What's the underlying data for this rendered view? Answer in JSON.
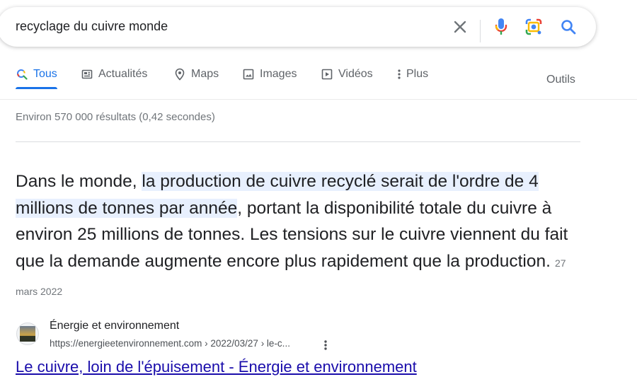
{
  "search": {
    "query": "recyclage du cuivre monde",
    "icons": {
      "clear": "close-icon",
      "voice": "microphone-icon",
      "lens": "camera-lens-icon",
      "search": "search-icon"
    }
  },
  "tabs": [
    {
      "label": "Tous",
      "icon": "search-icon",
      "active": true
    },
    {
      "label": "Actualités",
      "icon": "news-icon",
      "active": false
    },
    {
      "label": "Maps",
      "icon": "map-pin-icon",
      "active": false
    },
    {
      "label": "Images",
      "icon": "image-icon",
      "active": false
    },
    {
      "label": "Vidéos",
      "icon": "video-icon",
      "active": false
    },
    {
      "label": "Plus",
      "icon": "more-vert-icon",
      "active": false
    }
  ],
  "tools_label": "Outils",
  "stats": "Environ 570 000 résultats (0,42 secondes)",
  "snippet": {
    "text_before": "Dans le monde, ",
    "highlighted": "la production de cuivre recyclé serait de l'ordre de 4 millions de tonnes par année",
    "text_after": ", portant la disponibilité totale du cuivre à environ 25 millions de tonnes. Les tensions sur le cuivre viennent du fait que la demande augmente encore plus rapidement que la production.",
    "date": "27 mars 2022"
  },
  "source": {
    "site_name": "Énergie et environnement",
    "url": "https://energieetenvironnement.com › 2022/03/27 › le-c...",
    "title": "Le cuivre, loin de l'épuisement - Énergie et environnement"
  },
  "colors": {
    "link": "#1a0dab",
    "active_tab": "#1a73e8",
    "highlight": "#e8f0fe",
    "google_blue": "#4285f4",
    "google_red": "#ea4335",
    "google_yellow": "#fbbc04",
    "google_green": "#34a853"
  }
}
